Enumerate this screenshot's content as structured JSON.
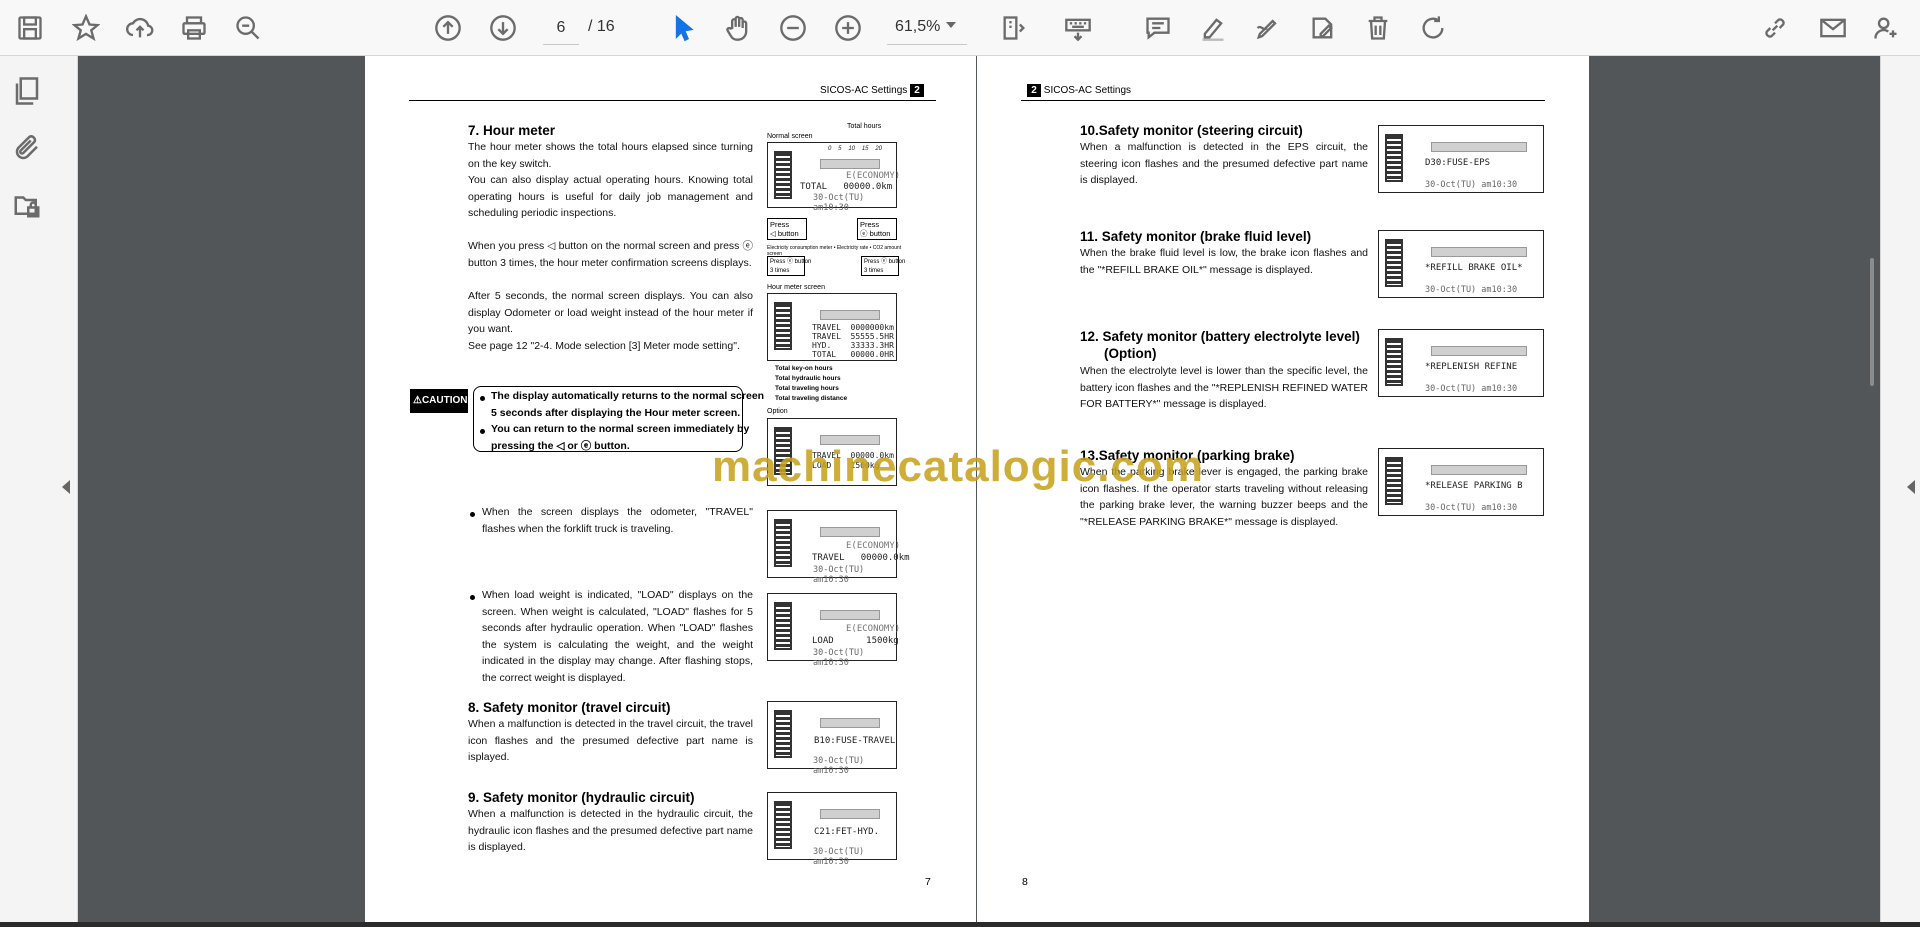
{
  "toolbar": {
    "page_current": "6",
    "page_total": "/ 16",
    "zoom": "61,5%",
    "icons": [
      "save-icon",
      "bookmark-star-icon",
      "upload-cloud-icon",
      "print-icon",
      "search-zoom-icon",
      "page-up-icon",
      "page-down-icon",
      "select-cursor-icon",
      "hand-icon",
      "zoom-out-icon",
      "zoom-in-icon",
      "fit-page-icon",
      "keyboard-icon",
      "comment-icon",
      "highlight-icon",
      "draw-icon",
      "edit-text-icon",
      "delete-icon",
      "rotate-icon",
      "share-link-icon",
      "email-icon",
      "add-user-icon"
    ]
  },
  "left_page": {
    "header": "SICOS-AC Settings",
    "header_num": "2",
    "s7_title": "7. Hour meter",
    "s7_p1": "The hour meter shows the total hours elapsed since turning on the key switch.",
    "s7_p2": "You can also display actual operating hours. Knowing total operating hours is useful for daily job management and scheduling periodic inspections.",
    "s7_p3": "When you press ◁ button on the normal screen and press ⓔ button 3 times, the hour meter confirmation screens displays.",
    "s7_p4": "After 5 seconds, the normal screen displays. You can also display Odometer or load weight instead of the hour meter if you want.",
    "s7_p5": "See page 12 \"2-4. Mode selection [3] Meter mode setting\".",
    "caution_label": "⚠CAUTION",
    "caution_1a": "The display automatically returns to the normal screen",
    "caution_1b": "5 seconds after displaying the Hour meter screen.",
    "caution_2a": "You can return to the normal screen immediately by",
    "caution_2b": "pressing the ◁ or ⓔ button.",
    "bullet_1": "When the screen displays the odometer, \"TRAVEL\" flashes when the forklift truck is traveling.",
    "bullet_2": "When load weight is indicated, \"LOAD\" displays on the screen. When weight is calculated, \"LOAD\" flashes for 5 seconds after hydraulic operation. When \"LOAD\" flashes the system is calculating the weight, and the weight indicated in the display may change. After flashing stops, the correct weight is displayed.",
    "s8_title": "8. Safety monitor (travel circuit)",
    "s8_p": "When a malfunction is detected in the travel circuit, the travel icon flashes and the presumed defective part name is isplayed.",
    "s9_title": "9. Safety monitor (hydraulic circuit)",
    "s9_p": "When a malfunction is detected in the hydraulic circuit, the hydraulic icon flashes and the presumed defective part name is displayed.",
    "page_number": "7",
    "fig_total_hours": "Total hours",
    "fig_normal_screen": "Normal screen",
    "fig_hour_meter_screen": "Hour meter screen",
    "fig_option": "Option",
    "fig_press_left": "Press\n◁ button",
    "fig_press_right": "Press\nⓔ button",
    "fig_press_3_left": "Press ⓔ button\n3 times",
    "fig_press_3_right": "Press ⓔ button\n3 times",
    "fig_caption_mid": "Electricity consumption meter • Electricity rate • CO2 amount screen",
    "fig_key_on": "Total key-on hours",
    "fig_hyd_hours": "Total hydraulic hours",
    "fig_trav_hours": "Total traveling hours",
    "fig_trav_dist": "Total traveling distance",
    "lcd_economy": "E(ECONOMY)",
    "lcd_total_line": "TOTAL   00000.0km",
    "lcd_date": "30-Oct(TU)  am10:30",
    "lcd_hm_lines": "TRAVEL  0000000km\nTRAVEL  55555.5HR\nHYD.    33333.3HR\nTOTAL   00000.0HR",
    "lcd_opt_lines": "TRAVEL  00000.0km\nLOAD    1500kg",
    "lcd_travel": "TRAVEL   00000.0km",
    "lcd_load": "LOAD      1500kg",
    "lcd_s8": "B10:FUSE-TRAVEL",
    "lcd_s9": "C21:FET-HYD.",
    "scale_nums": [
      "0",
      "5",
      "10",
      "15",
      "20"
    ]
  },
  "right_page": {
    "header": "SICOS-AC Settings",
    "header_num": "2",
    "s10_title": "10.Safety monitor (steering circuit)",
    "s10_p": "When a malfunction is detected in the EPS circuit, the steering icon flashes and the presumed defective part name is displayed.",
    "s11_title": "11. Safety monitor (brake fluid level)",
    "s11_p": "When the brake fluid level is low, the brake icon flashes and the \"*REFILL BRAKE OIL*\" message is displayed.",
    "s12_title_a": "12. Safety monitor (battery electrolyte level)",
    "s12_title_b": "(Option)",
    "s12_p": "When the electrolyte level is lower than the specific level, the battery icon flashes and the \"*REPLENISH REFINED WATER FOR BATTERY*\" message is displayed.",
    "s13_title": "13.Safety monitor (parking brake)",
    "s13_p": "When the parking brake lever is engaged, the parking brake icon flashes. If the operator starts traveling without releasing the parking brake lever, the warning buzzer beeps and the \"*RELEASE PARKING BRAKE*\" message is displayed.",
    "page_number": "8",
    "lcd_s10": "D30:FUSE-EPS",
    "lcd_s11": "*REFILL BRAKE OIL*",
    "lcd_s12": "*REPLENISH REFINE",
    "lcd_s13": "*RELEASE PARKING B",
    "lcd_date": "30-Oct(TU)   am10:30"
  },
  "watermark": "machinecatalogic.com"
}
